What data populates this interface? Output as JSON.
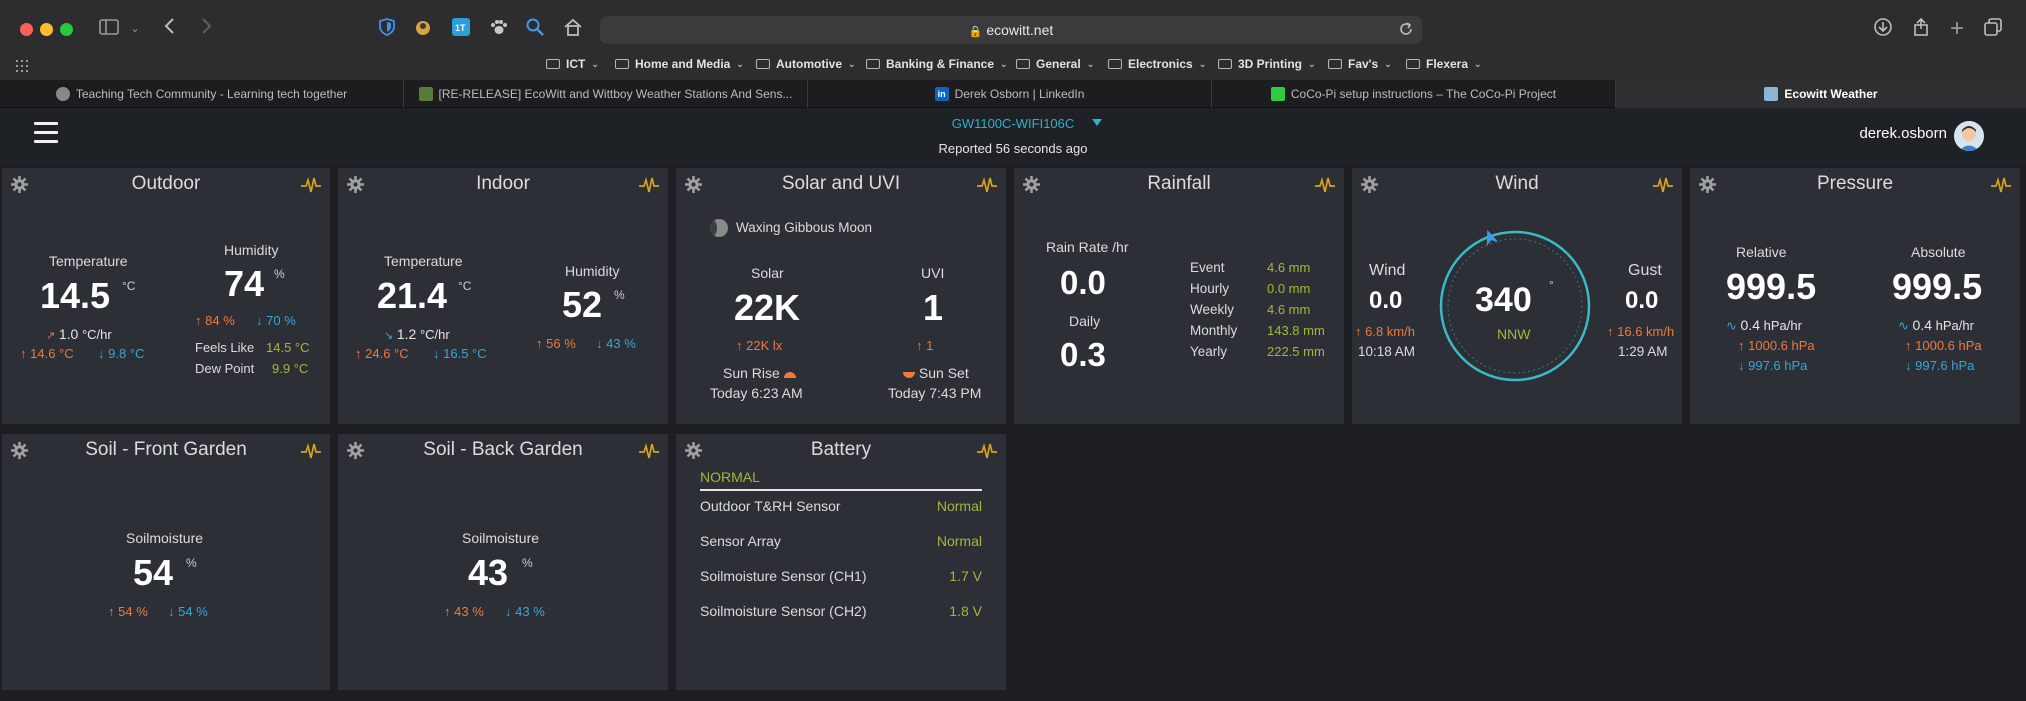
{
  "browser": {
    "url": "ecowitt.net",
    "bookmarks": [
      "ICT",
      "Home and Media",
      "Automotive",
      "Banking & Finance",
      "General",
      "Electronics",
      "3D Printing",
      "Fav's",
      "Flexera"
    ],
    "tabs": [
      "Teaching Tech Community - Learning tech together",
      "[RE-RELEASE] EcoWitt and Wittboy Weather Stations And Sens...",
      "Derek Osborn | LinkedIn",
      "CoCo-Pi setup instructions – The CoCo-Pi Project",
      "Ecowitt Weather"
    ]
  },
  "header": {
    "device": "GW1100C-WIFI106C",
    "reported": "Reported 56 seconds ago",
    "user": "derek.osborn"
  },
  "outdoor": {
    "title": "Outdoor",
    "temp_label": "Temperature",
    "temp": "14.5",
    "temp_unit": "°C",
    "rate": "1.0",
    "rate_unit": "°C/hr",
    "temp_hi": "14.6 °C",
    "temp_lo": "9.8 °C",
    "hum_label": "Humidity",
    "hum": "74",
    "hum_unit": "%",
    "hum_hi": "84 %",
    "hum_lo": "70 %",
    "feels_label": "Feels Like",
    "feels": "14.5 °C",
    "dew_label": "Dew Point",
    "dew": "9.9 °C"
  },
  "indoor": {
    "title": "Indoor",
    "temp_label": "Temperature",
    "temp": "21.4",
    "temp_unit": "°C",
    "rate": "1.2",
    "rate_unit": "°C/hr",
    "temp_hi": "24.6 °C",
    "temp_lo": "16.5 °C",
    "hum_label": "Humidity",
    "hum": "52",
    "hum_unit": "%",
    "hum_hi": "56 %",
    "hum_lo": "43 %"
  },
  "solar": {
    "title": "Solar and UVI",
    "moon": "Waxing Gibbous Moon",
    "solar_label": "Solar",
    "solar": "22K",
    "solar_hi": "22K lx",
    "uvi_label": "UVI",
    "uvi": "1",
    "uvi_hi": "1",
    "sunrise_label": "Sun Rise",
    "sunrise": "Today 6:23 AM",
    "sunset_label": "Sun Set",
    "sunset": "Today 7:43 PM"
  },
  "rainfall": {
    "title": "Rainfall",
    "rate_label": "Rain Rate /hr",
    "rate": "0.0",
    "daily_label": "Daily",
    "daily": "0.3",
    "rows": [
      {
        "label": "Event",
        "value": "4.6 mm"
      },
      {
        "label": "Hourly",
        "value": "0.0 mm"
      },
      {
        "label": "Weekly",
        "value": "4.6 mm"
      },
      {
        "label": "Monthly",
        "value": "143.8 mm"
      },
      {
        "label": "Yearly",
        "value": "222.5 mm"
      }
    ]
  },
  "wind": {
    "title": "Wind",
    "wind_label": "Wind",
    "wind": "0.0",
    "wind_hi": "6.8 km/h",
    "wind_time": "10:18 AM",
    "dir": "340",
    "dir_unit": "°",
    "dir_name": "NNW",
    "dir_degrees": 340,
    "gust_label": "Gust",
    "gust": "0.0",
    "gust_hi": "16.6 km/h",
    "gust_time": "1:29 AM"
  },
  "pressure": {
    "title": "Pressure",
    "rel_label": "Relative",
    "rel": "999.5",
    "rel_rate": "0.4",
    "rel_rate_unit": "hPa/hr",
    "rel_hi": "1000.6 hPa",
    "rel_lo": "997.6 hPa",
    "abs_label": "Absolute",
    "abs": "999.5",
    "abs_rate": "0.4",
    "abs_rate_unit": "hPa/hr",
    "abs_hi": "1000.6 hPa",
    "abs_lo": "997.6 hPa"
  },
  "soil_front": {
    "title": "Soil - Front Garden",
    "label": "Soilmoisture",
    "value": "54",
    "unit": "%",
    "hi": "54 %",
    "lo": "54 %"
  },
  "soil_back": {
    "title": "Soil - Back Garden",
    "label": "Soilmoisture",
    "value": "43",
    "unit": "%",
    "hi": "43 %",
    "lo": "43 %"
  },
  "battery": {
    "title": "Battery",
    "status": "NORMAL",
    "rows": [
      {
        "label": "Outdoor T&RH Sensor",
        "value": "Normal"
      },
      {
        "label": "Sensor Array",
        "value": "Normal"
      },
      {
        "label": "Soilmoisture Sensor (CH1)",
        "value": "1.7 V"
      },
      {
        "label": "Soilmoisture Sensor (CH2)",
        "value": "1.8 V"
      }
    ]
  },
  "colors": {
    "accent": "#2bb2c9",
    "high": "#f07a3a",
    "low": "#3aa5db",
    "value_yellow": "#a6b63a",
    "card": "#2c2f35",
    "background": "#1c1e22"
  }
}
